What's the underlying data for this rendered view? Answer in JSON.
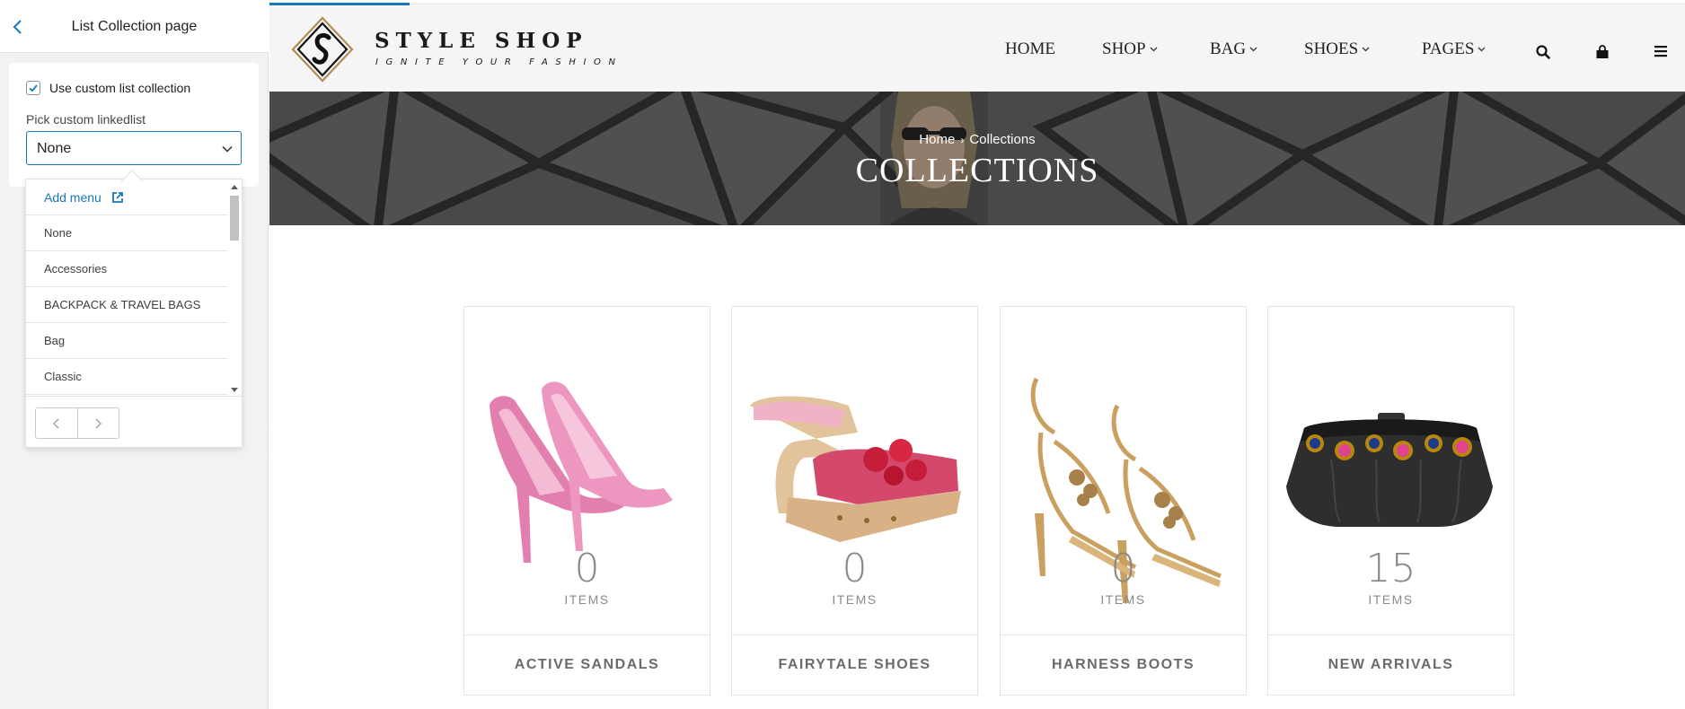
{
  "editor": {
    "title": "List Collection page",
    "use_custom_label": "Use custom list collection",
    "use_custom_checked": true,
    "pick_label": "Pick custom linkedlist",
    "selected": "None",
    "dropdown": {
      "add_menu": "Add menu",
      "items": [
        "None",
        "Accessories",
        "BACKPACK & TRAVEL BAGS",
        "Bag",
        "Classic"
      ]
    }
  },
  "store": {
    "brand": "STYLE SHOP",
    "tagline": "IGNITE YOUR FASHION",
    "nav": {
      "home": "HOME",
      "shop": "SHOP",
      "bag": "BAG",
      "shoes": "SHOES",
      "pages": "PAGES"
    },
    "breadcrumb": {
      "home": "Home",
      "separator": "›",
      "current": "Collections"
    },
    "banner_title": "COLLECTIONS",
    "items_label": "ITEMS",
    "collections": [
      {
        "name": "ACTIVE SANDALS",
        "count": "0"
      },
      {
        "name": "FAIRYTALE SHOES",
        "count": "0"
      },
      {
        "name": "HARNESS BOOTS",
        "count": "0"
      },
      {
        "name": "NEW ARRIVALS",
        "count": "15"
      }
    ]
  },
  "colors": {
    "accent": "#1878b9",
    "panel_bg": "#f1f2f4",
    "header_bg": "#f5f5f5"
  },
  "icons": [
    "chevron-left-icon",
    "checkbox-checked-icon",
    "chevron-down-icon",
    "external-link-icon",
    "search-icon",
    "bag-icon",
    "menu-icon",
    "collapse-arrow-icon"
  ]
}
